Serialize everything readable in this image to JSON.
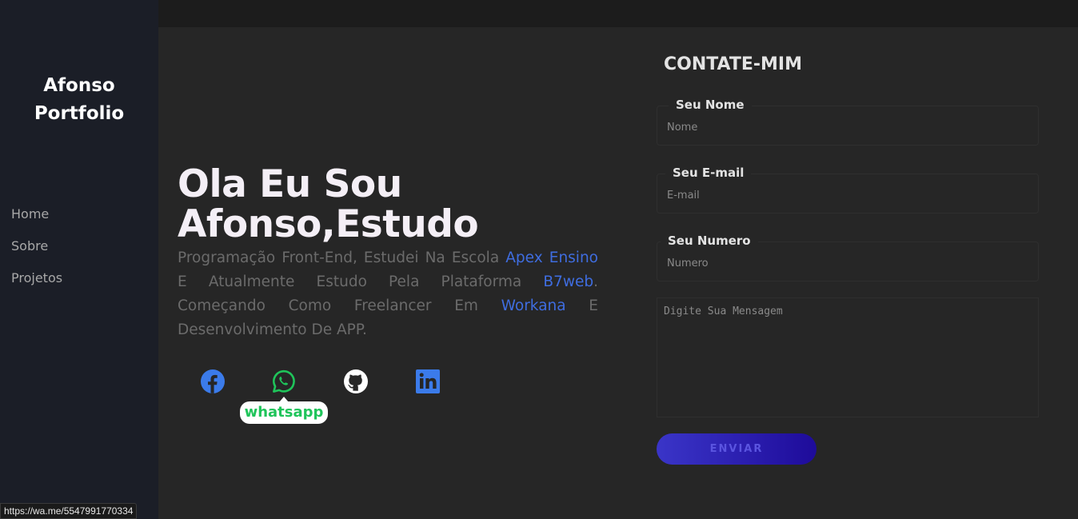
{
  "brand": {
    "line1": "Afonso",
    "line2": "Portfolio"
  },
  "nav": {
    "items": [
      {
        "label": "Home"
      },
      {
        "label": "Sobre"
      },
      {
        "label": "Projetos"
      }
    ]
  },
  "hero": {
    "title_line1": "Ola Eu Sou",
    "title_line2": "Afonso,Estudo",
    "text_1": "Programação Front-End, Estudei Na Escola ",
    "link_1": "Apex Ensino",
    "text_2": " E Atualmente Estudo Pela Plataforma ",
    "link_2": "B7web",
    "text_3": ". Começando Como Freelancer Em ",
    "link_3": "Workana",
    "text_4": " E Desenvolvimento De APP."
  },
  "socials": [
    {
      "icon": "facebook-icon",
      "color": "#3b7bea"
    },
    {
      "icon": "whatsapp-icon",
      "color": "#1fc45a"
    },
    {
      "icon": "github-icon",
      "color": "#ffffff"
    },
    {
      "icon": "linkedin-icon",
      "color": "#3b7bea"
    }
  ],
  "tooltip": {
    "label": "whatsapp"
  },
  "contact": {
    "title": "CONTATE-MIM",
    "name_label": "Seu Nome",
    "name_placeholder": "Nome",
    "email_label": "Seu E-mail",
    "email_placeholder": "E-mail",
    "phone_label": "Seu Numero",
    "phone_placeholder": "Numero",
    "message_placeholder": "Digite Sua Mensagem",
    "send_label": "ENVIAR"
  },
  "status": {
    "url": "https://wa.me/5547991770334"
  },
  "colors": {
    "accent": "#3f6de0",
    "sidebar": "#1b1e27",
    "background": "#262626",
    "button_start": "#3a35c8",
    "button_end": "#1e0b9a"
  }
}
